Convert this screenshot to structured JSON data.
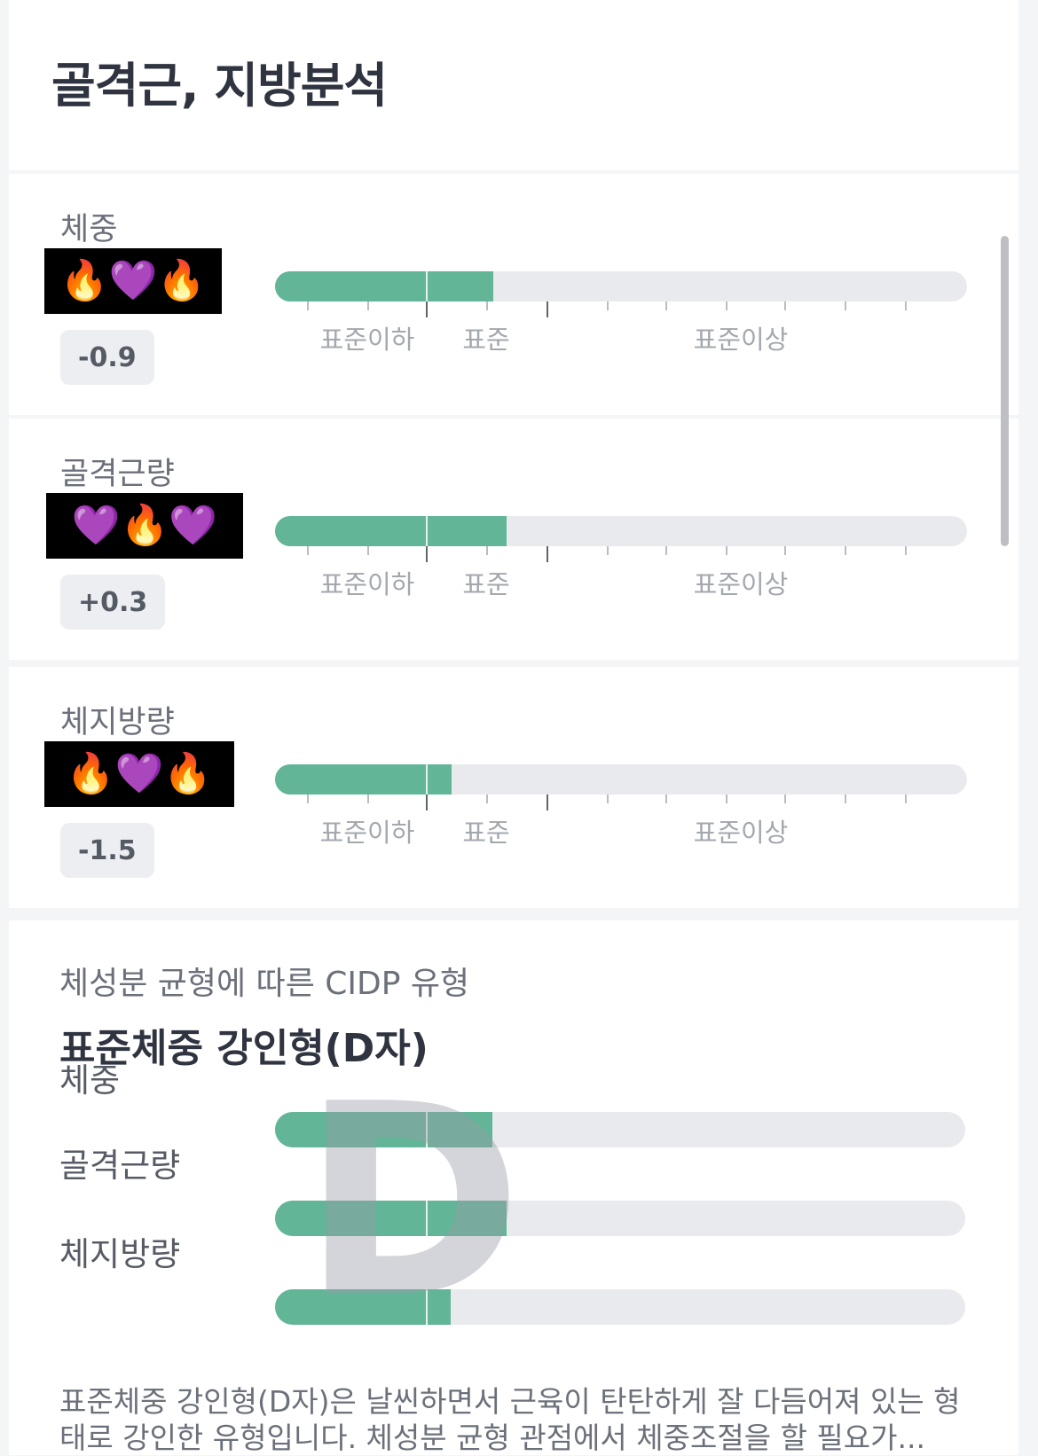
{
  "header": {
    "title": "골격근, 지방분석"
  },
  "zone_labels": [
    "표준이하",
    "표준",
    "표준이상"
  ],
  "metrics": [
    {
      "label": "체중",
      "emojis": "🔥💜🔥",
      "delta": "-0.9",
      "fill_pct": 31.5
    },
    {
      "label": "골격근량",
      "emojis": "💜🔥💜",
      "delta": "+0.3",
      "fill_pct": 33.5
    },
    {
      "label": "체지방량",
      "emojis": "🔥💜🔥",
      "delta": "-1.5",
      "fill_pct": 25.5
    }
  ],
  "cidp": {
    "subtitle": "체성분 균형에 따른 CIDP 유형",
    "title": "표준체중 강인형(D자)",
    "letter": "D",
    "rows": [
      {
        "label": "체중",
        "fill_pct": 31.5
      },
      {
        "label": "골격근량",
        "fill_pct": 33.5
      },
      {
        "label": "체지방량",
        "fill_pct": 25.5
      }
    ],
    "description": "표준체중 강인형(D자)은 날씬하면서 근육이 탄탄하게 잘 다듬어져 있는 형태로 강인한 유형입니다. 체성분 균형 관점에서 체중조절을 할 필요가..."
  },
  "colors": {
    "fill": "#62b596",
    "track": "#e9eaed"
  }
}
